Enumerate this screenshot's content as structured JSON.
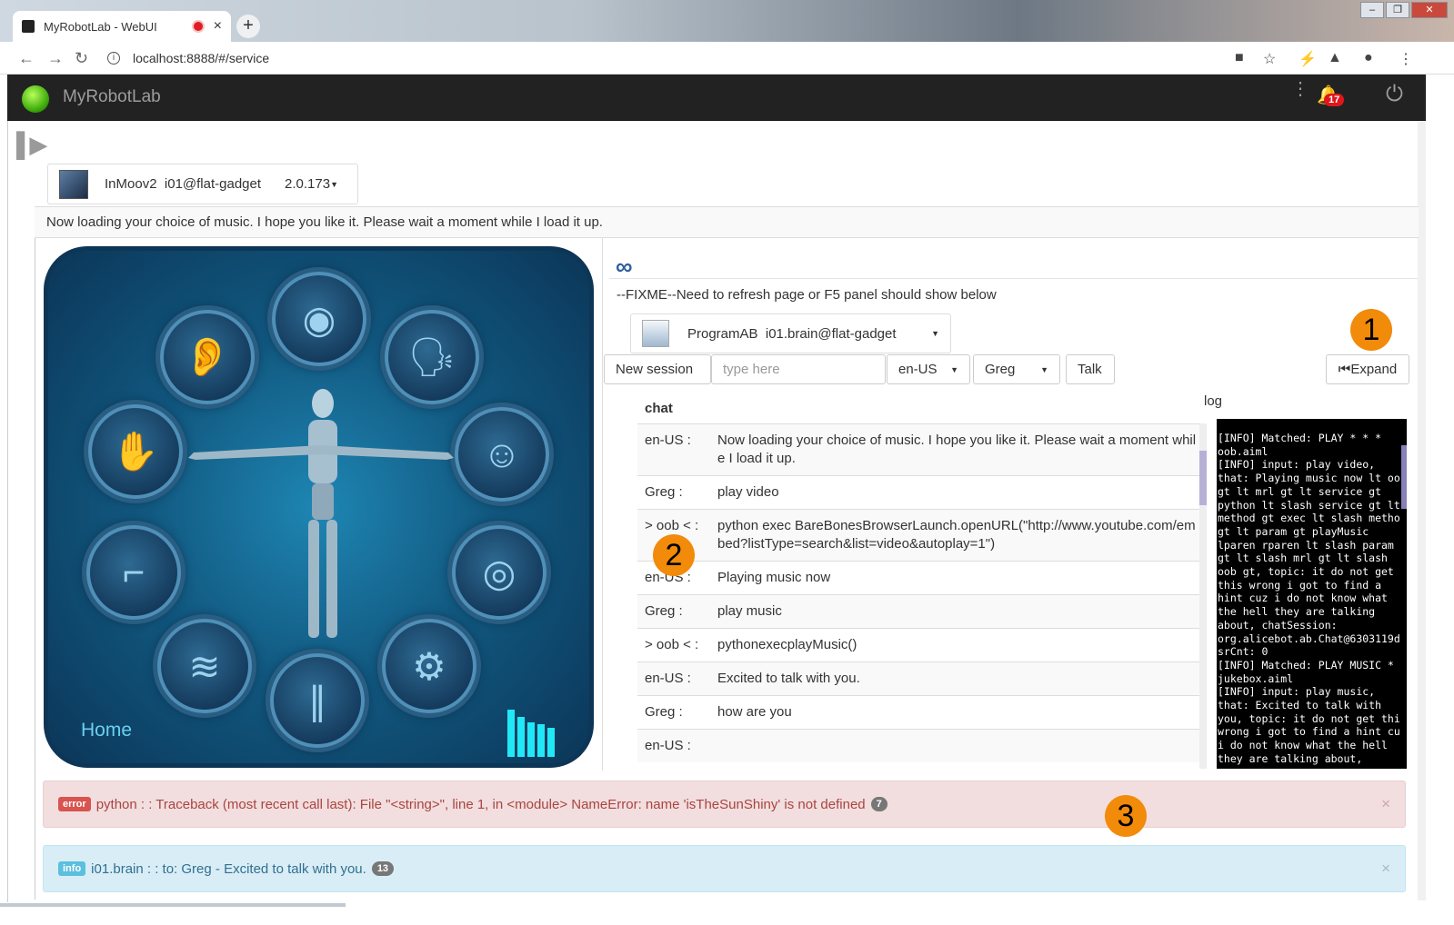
{
  "browser": {
    "tab_title": "MyRobotLab - WebUI",
    "tab_close": "×",
    "new_tab": "+",
    "url": "localhost:8888/#/service",
    "window_controls": [
      "–",
      "❐",
      "✕"
    ]
  },
  "app": {
    "brand": "MyRobotLab",
    "notification_count": "17"
  },
  "service": {
    "name": "InMoov2",
    "instance": "i01@flat-gadget",
    "version": "2.0.173"
  },
  "status_message": "Now loading your choice of music. I hope you like it. Please wait a moment while I load it up.",
  "robot_panel": {
    "home_label": "Home",
    "parts": [
      "ear-icon",
      "brain-icon",
      "mouth-icon",
      "hand-icon",
      "head-icon",
      "arm-icon",
      "torso-icon",
      "sensor-icon",
      "legs-icon",
      "settings-icon"
    ]
  },
  "chatbot": {
    "fixme": "--FIXME--Need to refresh page or F5 panel should show below",
    "service_name": "ProgramAB",
    "service_instance": "i01.brain@flat-gadget",
    "new_session": "New session",
    "input_placeholder": "type here",
    "locale": "en-US",
    "user": "Greg",
    "talk": "Talk",
    "expand": "Expand",
    "chat_header": "chat",
    "log_header": "log",
    "rows": [
      {
        "who": "en-US :",
        "text": "Now loading your choice of music. I hope you like it. Please wait a moment while I load it up."
      },
      {
        "who": "Greg :",
        "text": "play video"
      },
      {
        "who": "> oob < :",
        "text": "python exec BareBonesBrowserLaunch.openURL(\"http://www.youtube.com/embed?listType=search&list=video&autoplay=1\")"
      },
      {
        "who": "en-US :",
        "text": "Playing music now"
      },
      {
        "who": "Greg :",
        "text": "play music"
      },
      {
        "who": "> oob < :",
        "text": "pythonexecplayMusic()"
      },
      {
        "who": "en-US :",
        "text": "Excited to talk with you."
      },
      {
        "who": "Greg :",
        "text": "how are you"
      },
      {
        "who": "en-US :",
        "text": ""
      }
    ],
    "log": "[INFO] Matched: PLAY * * *\noob.aiml\n[INFO] input: play video,\nthat: Playing music now lt oo\ngt lt mrl gt lt service gt\npython lt slash service gt lt\nmethod gt exec lt slash metho\ngt lt param gt playMusic\nlparen rparen lt slash param\ngt lt slash mrl gt lt slash\noob gt, topic: it do not get\nthis wrong i got to find a\nhint cuz i do not know what\nthe hell they are talking\nabout, chatSession:\norg.alicebot.ab.Chat@6303119d\nsrCnt: 0\n[INFO] Matched: PLAY MUSIC *\njukebox.aiml\n[INFO] input: play music,\nthat: Excited to talk with\nyou, topic: it do not get thi\nwrong i got to find a hint cu\ni do not know what the hell\nthey are talking about,"
  },
  "callouts": [
    "1",
    "2",
    "3"
  ],
  "alerts": [
    {
      "label": "error",
      "text": "python : : Traceback (most recent call last): File \"<string>\", line 1, in <module> NameError: name 'isTheSunShiny' is not defined",
      "count": "7"
    },
    {
      "label": "info",
      "text": "i01.brain : : to: Greg - Excited to talk with you.",
      "count": "13"
    }
  ],
  "colors": {
    "header_bg": "#222222",
    "callout": "#f28a0a",
    "error_bg": "#f2dede",
    "info_bg": "#d9edf7"
  }
}
